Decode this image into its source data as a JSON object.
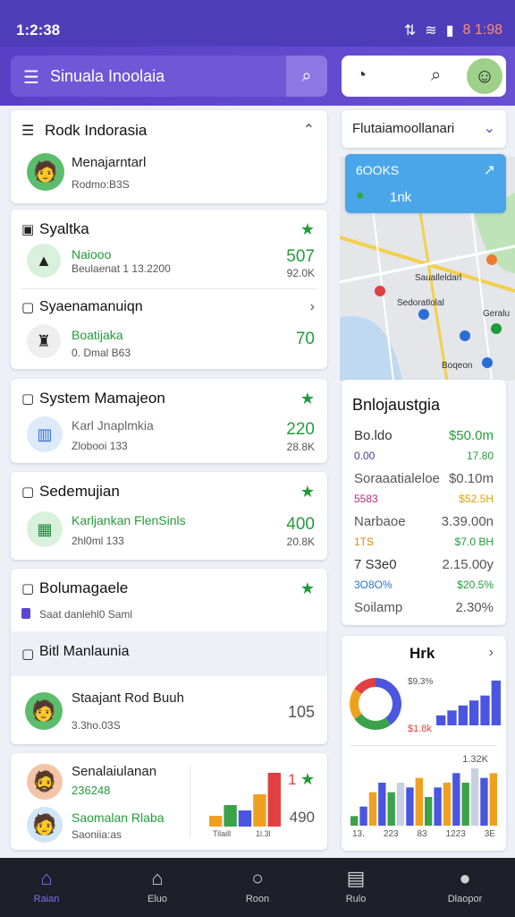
{
  "status": {
    "time": "1:2:38",
    "right_text": "8 1:98"
  },
  "appbar": {
    "title": "Sinuala Inoolaia"
  },
  "card1": {
    "title": "Rodk Indorasia",
    "name": "Menajarntarl",
    "sub": "Rodmo:B3S"
  },
  "card2": {
    "title": "Syaltka",
    "row1": {
      "label": "Naiooo",
      "sub": "Beulaenat 1 13.2200",
      "value": "507",
      "sub_value": "92.0K"
    },
    "subtitle": "Syaenamanuiqn",
    "row2": {
      "label": "Boatijaka",
      "sub": "0. Dmal B63",
      "value": "70"
    }
  },
  "card3": {
    "title": "System Mamajeon",
    "label": "Karl Jnaplmkia",
    "sub": "Zlobooi 133",
    "value": "220",
    "sub_value": "28.8K"
  },
  "card4": {
    "title": "Sedemujian",
    "label": "Karljankan FlenSinls",
    "sub": "2hl0ml 133",
    "value": "400",
    "sub_value": "20.8K"
  },
  "card5": {
    "title": "Bolumagaele",
    "sub": "Saat danlehl0 Saml",
    "subtitle": "Bitl Manlaunia",
    "person": {
      "name": "Staajant Rod Buuh",
      "sub": "3.3ho.03S",
      "value": "105"
    }
  },
  "card6": {
    "person1": {
      "name": "Senalaiulanan",
      "sub": "236248"
    },
    "person2": {
      "name": "Saomalan Rlaba",
      "sub": "Saoniia:as"
    },
    "value1": "1",
    "value2": "490",
    "axis": [
      "Tilaill",
      "1l.3l"
    ]
  },
  "right_header": {
    "title": "Flutaiamoollanari"
  },
  "blue_card": {
    "title": "6OOKS",
    "sub": "1nk"
  },
  "map": {
    "labels": [
      "Saualleldarl",
      "Sedoratlolal",
      "Geralu",
      "Boqeon"
    ]
  },
  "finance": {
    "title": "Bnlojaustgia",
    "rows": [
      {
        "left": "Bo.ldo",
        "right": "$50.0m",
        "lcolor": "#333",
        "rcolor": "#239c3a"
      },
      {
        "left": "0.00",
        "right": "17.80",
        "lcolor": "#4338b0",
        "rcolor": "#239c3a"
      },
      {
        "left": "Soraaatialeloe",
        "right": "$0.10m",
        "lcolor": "#555",
        "rcolor": "#555"
      },
      {
        "left": "5583",
        "right": "$52.5H",
        "lcolor": "#c0267a",
        "rcolor": "#e0a000"
      },
      {
        "left": "Narbaoe",
        "right": "3.39.00n",
        "lcolor": "#555",
        "rcolor": "#555"
      },
      {
        "left": "1TS",
        "right": "$7.0 BH",
        "lcolor": "#e08a00",
        "rcolor": "#239c3a"
      },
      {
        "left": "7 S3e0",
        "right": "2.15.00y",
        "lcolor": "#333",
        "rcolor": "#555"
      },
      {
        "left": "3O8O%",
        "right": "$20.5%",
        "lcolor": "#2476d6",
        "rcolor": "#239c3a"
      },
      {
        "left": "Soilamp",
        "right": "2.30%",
        "lcolor": "#555",
        "rcolor": "#555"
      }
    ]
  },
  "chart_card": {
    "title": "Hrk",
    "donut_value": "$9.3%",
    "pct_label": "$1.8k",
    "total": "1.32K",
    "axis": [
      "13.",
      "223",
      "83",
      "1223",
      "3E"
    ]
  },
  "chart_data": [
    {
      "type": "bar",
      "values": [
        2,
        4,
        3,
        6,
        10
      ]
    },
    {
      "type": "pie",
      "values": [
        40,
        25,
        20,
        15
      ],
      "colors": [
        "#4a55e0",
        "#3ba24a",
        "#f0a020",
        "#e14040"
      ]
    },
    {
      "type": "bar",
      "values": [
        2,
        3,
        4,
        5,
        6,
        9
      ]
    },
    {
      "type": "bar",
      "values": [
        2,
        4,
        7,
        9,
        7,
        9,
        8,
        10,
        6,
        8,
        9,
        11,
        9,
        12,
        10,
        11
      ]
    }
  ],
  "nav": [
    {
      "label": "Raian",
      "icon": "home-icon"
    },
    {
      "label": "Eluo",
      "icon": "shape-icon"
    },
    {
      "label": "Roon",
      "icon": "circle-icon"
    },
    {
      "label": "Rulo",
      "icon": "calendar-icon"
    },
    {
      "label": "Dlaopor",
      "icon": "person-icon"
    }
  ]
}
